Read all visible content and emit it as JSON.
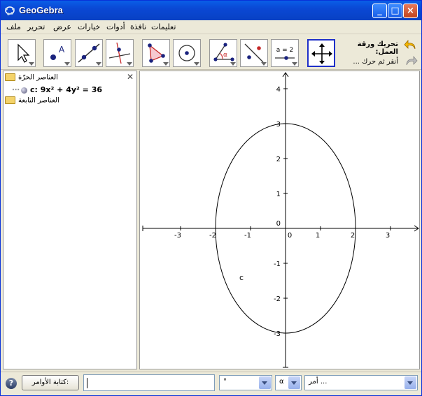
{
  "window": {
    "title": "GeoGebra"
  },
  "menu": [
    "ملف",
    "تحرير",
    "عرض",
    "خيارات",
    "أدوات",
    "نافذة",
    "تعليمات"
  ],
  "tools": [
    {
      "name": "move-tool-icon"
    },
    {
      "name": "new-point-tool-icon"
    },
    {
      "name": "line-tool-icon"
    },
    {
      "name": "perpendicular-tool-icon"
    },
    {
      "name": "polygon-tool-icon"
    },
    {
      "name": "circle-tool-icon"
    },
    {
      "name": "angle-tool-icon"
    },
    {
      "name": "reflect-tool-icon"
    },
    {
      "name": "slider-tool-icon",
      "label": "a = 2"
    },
    {
      "name": "move-graphics-tool-icon"
    }
  ],
  "tool_help": {
    "title": "تحريك ورقة العمل:",
    "hint": "أنقر ثم حرك ..."
  },
  "algebra": {
    "free_folder": "العناصر الحرّة",
    "object": "c: 9x² + 4y² = 36",
    "dependent_folder": "العناصر التابعة"
  },
  "graphics": {
    "x_ticks": [
      "-3",
      "-2",
      "-1",
      "0",
      "1",
      "2",
      "3"
    ],
    "y_ticks": [
      "4",
      "3",
      "2",
      "1",
      "0",
      "-1",
      "-2",
      "-3"
    ],
    "curve_label": "c",
    "ellipse": {
      "a": 2,
      "b": 3
    }
  },
  "bottom": {
    "input_button": "كتابة الأوامر:",
    "input_value": "",
    "symbol_combo": "°",
    "greek_combo": "α",
    "command_combo": "أمر ..."
  },
  "colors": {
    "title_bar": "#0a5ee7",
    "selected_tool": "#1e2fc8"
  }
}
